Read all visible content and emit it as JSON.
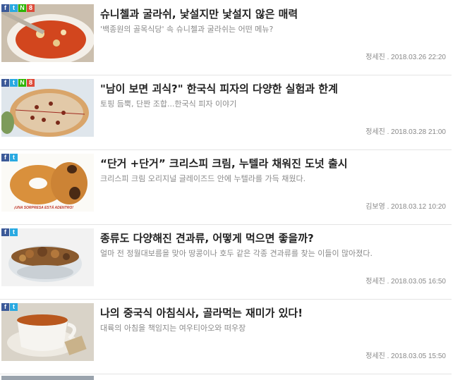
{
  "share_labels": {
    "facebook": "f",
    "twitter": "t",
    "naver": "N",
    "google": "8"
  },
  "articles": [
    {
      "title": "슈니첼과 굴라쉬, 낯설지만 낯설지 않은 매력",
      "desc": "'백종원의 골목식당' 속 슈니첼과 굴라쉬는 어떤 메뉴?",
      "author": "정세진",
      "date": "2018.03.26 22:20",
      "thumb_icon": "goulash-soup-icon"
    },
    {
      "title": "\"남이 보면 괴식?\" 한국식 피자의 다양한 실험과 한계",
      "desc": "토핑 듬뿍, 단짠 조합...한국식 피자 이야기",
      "author": "정세진",
      "date": "2018.03.28 21:00",
      "thumb_icon": "pizza-icon"
    },
    {
      "title": "“단거 +단거” 크리스피 크림, 누텔라 채워진 도넛 출시",
      "desc": "크리스피 크림 오리지널 글레이즈드 안에 누텔라를 가득 채웠다.",
      "author": "김보영",
      "date": "2018.03.12 10:20",
      "thumb_icon": "donut-icon",
      "thumb_caption": "¡UNA SORPRESA ESTÁ ADENTRO!"
    },
    {
      "title": "종류도 다양해진 견과류, 어떻게 먹으면 좋을까?",
      "desc": "얼마 전 정월대보름을 맞아 땅콩이나 호두 같은 각종 견과류를 찾는 이들이 많아졌다.",
      "author": "정세진",
      "date": "2018.03.05 16:50",
      "thumb_icon": "nuts-bowl-icon"
    },
    {
      "title": "나의 중국식 아침식사, 골라먹는 재미가 있다!",
      "desc": "대륙의 아침을 책임지는 여우티아오와 떠우장",
      "author": "정세진",
      "date": "2018.03.05 15:50",
      "thumb_icon": "tea-cup-icon"
    }
  ],
  "colors": {
    "title": "#222222",
    "desc": "#8a8a8a",
    "meta": "#888888",
    "divider": "#e4e4e4"
  }
}
